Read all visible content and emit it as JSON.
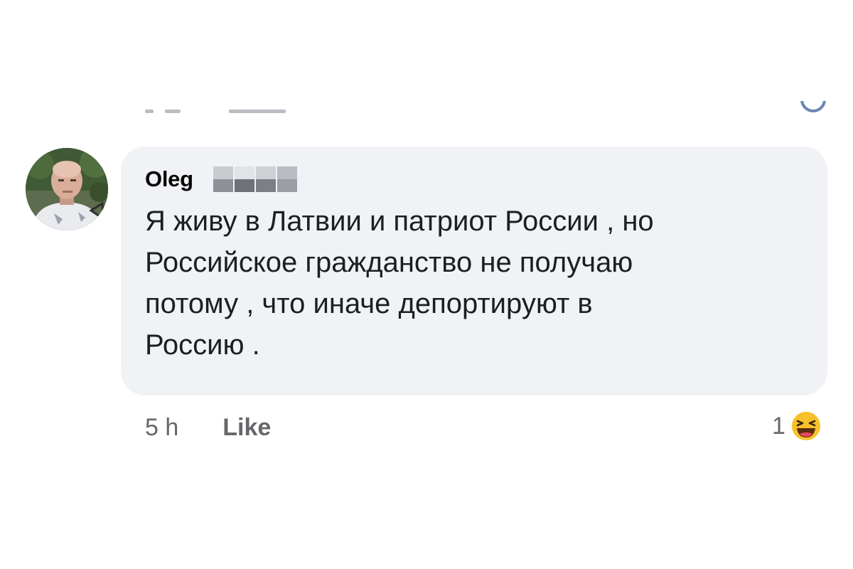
{
  "comment": {
    "author_name": "Oleg",
    "author_surname_blurred": true,
    "text": "Я живу в Латвии и патриот России , но\nРоссийское гражданство не получаю\nпотому , что иначе депортируют в\nРоссию .",
    "timestamp": "5 h",
    "like_label": "Like",
    "reaction_count": "1",
    "reaction_icon": "haha-emoji-icon"
  },
  "colors": {
    "bubble_background": "#f0f2f5",
    "text": "#1c1e21",
    "secondary_text": "#65676b",
    "reaction_yellow": "#f7c12b"
  }
}
